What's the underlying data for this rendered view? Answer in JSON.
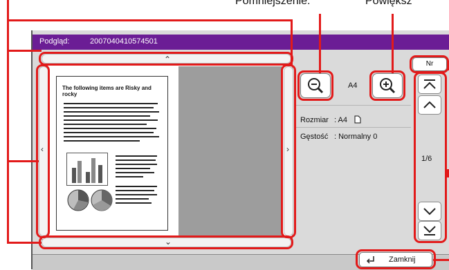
{
  "callouts": {
    "zoom_out": "Pomniejszenie:",
    "zoom_in": "Powiększ"
  },
  "title_bar": {
    "label": "Podgląd:",
    "filename": "2007040410574501"
  },
  "document_page": {
    "heading": "The following items are Risky and rocky",
    "text_lines": 10,
    "figures": [
      "bar-chart",
      "pie-chart",
      "pie-chart"
    ]
  },
  "zoom": {
    "zoom_out_icon": "magnifier-minus-icon",
    "zoom_in_icon": "magnifier-plus-icon",
    "paper_size": "A4"
  },
  "info": {
    "size_label": "Rozmiar",
    "size_value": ": A4",
    "density_label": "Gęstość",
    "density_value": ": Normalny 0"
  },
  "page_nav": {
    "current": "1/6",
    "number_button": "Nr"
  },
  "footer": {
    "close_button": "Zamknij"
  },
  "colors": {
    "titlebar": "#6b1d95",
    "callout": "#e21a1a"
  }
}
